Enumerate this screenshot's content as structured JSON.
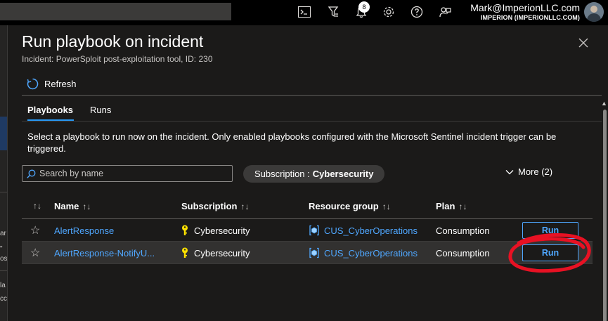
{
  "topbar": {
    "notification_count": "8",
    "account_name": "Mark@ImperionLLC.com",
    "account_org": "IMPERION (IMPERIONLLC.COM)"
  },
  "background_page": {
    "fragments": [
      "ar",
      "\"",
      "os",
      "la",
      "cc"
    ]
  },
  "panel": {
    "title": "Run playbook on incident",
    "subtitle": "Incident: PowerSploit post-exploitation tool, ID: 230",
    "refresh_label": "Refresh",
    "tabs": [
      {
        "label": "Playbooks",
        "selected": true
      },
      {
        "label": "Runs",
        "selected": false
      }
    ],
    "description": "Select a playbook to run now on the incident. Only enabled playbooks configured with the Microsoft Sentinel incident trigger can be triggered.",
    "search": {
      "placeholder": "Search by name",
      "value": ""
    },
    "subscription_filter": {
      "label": "Subscription :",
      "value": "Cybersecurity"
    },
    "more_label": "More (2)"
  },
  "table": {
    "columns": [
      "Name",
      "Subscription",
      "Resource group",
      "Plan"
    ],
    "rows": [
      {
        "name": "AlertResponse",
        "subscription": "Cybersecurity",
        "resource_group": "CUS_CyberOperations",
        "plan": "Consumption",
        "action": "Run"
      },
      {
        "name": "AlertResponse-NotifyU...",
        "subscription": "Cybersecurity",
        "resource_group": "CUS_CyberOperations",
        "plan": "Consumption",
        "action": "Run"
      }
    ]
  },
  "colors": {
    "accent": "#4fa7ff",
    "annotation": "#e81123",
    "key_icon": "#fce100",
    "panel_bg": "#1b1a19"
  },
  "icons": {
    "topbar": [
      "terminal-icon",
      "directory-filter-icon",
      "notification-bell-icon",
      "settings-gear-icon",
      "help-icon",
      "feedback-icon"
    ],
    "refresh": "refresh-icon",
    "close": "close-icon",
    "search": "search-icon",
    "more": "chevron-down-icon",
    "favorite": "star-icon",
    "subscription": "key-icon",
    "resource_group": "resource-group-icon"
  }
}
